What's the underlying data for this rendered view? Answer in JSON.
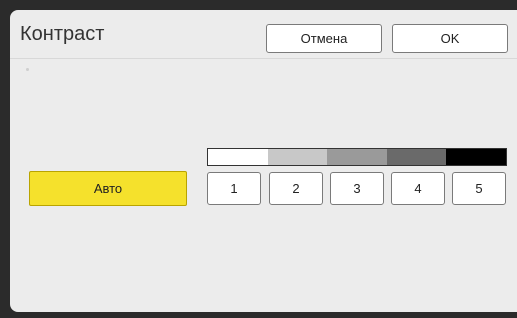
{
  "dialog": {
    "title": "Контраст",
    "cancel_label": "Отмена",
    "ok_label": "OK"
  },
  "auto": {
    "label": "Авто",
    "color": "#f5e12c"
  },
  "contrast_scale": {
    "shades": [
      "#ffffff",
      "#c8c8c8",
      "#9a9a9a",
      "#6a6a6a",
      "#000000"
    ]
  },
  "levels": [
    "1",
    "2",
    "3",
    "4",
    "5"
  ]
}
